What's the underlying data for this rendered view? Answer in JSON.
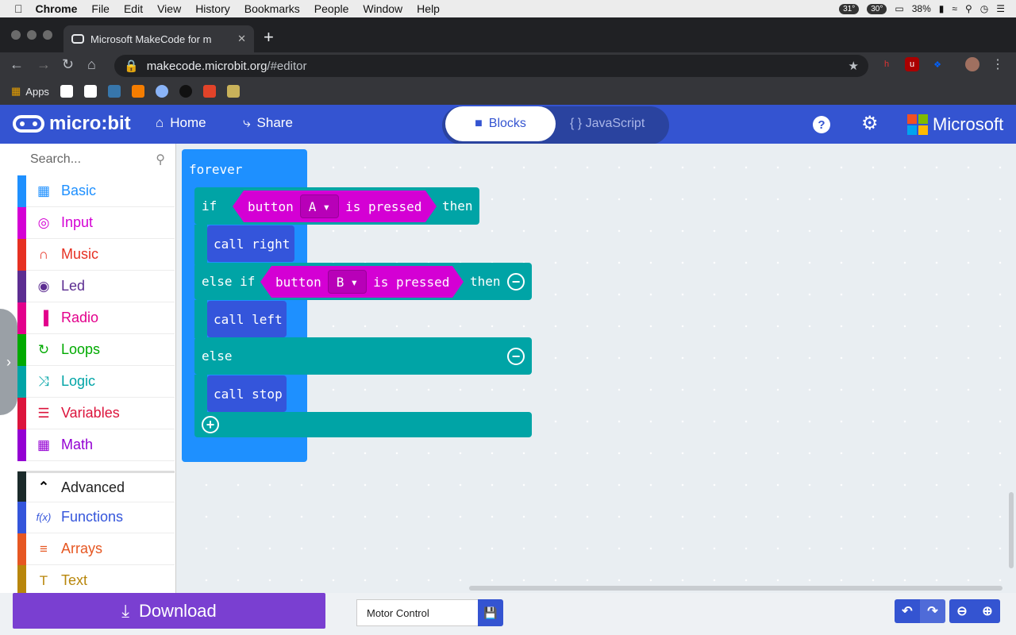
{
  "os_menubar": {
    "app": "Chrome",
    "menus": [
      "File",
      "Edit",
      "View",
      "History",
      "Bookmarks",
      "People",
      "Window",
      "Help"
    ],
    "temp1": "31°",
    "temp2": "30°",
    "battery": "38%"
  },
  "browser": {
    "tab_title": "Microsoft MakeCode for m",
    "url_host": "makecode.microbit.org",
    "url_path": "/#editor",
    "bookmarks_label": "Apps"
  },
  "header": {
    "logo": "micro:bit",
    "home": "Home",
    "share": "Share",
    "blocks": "Blocks",
    "javascript": "{ } JavaScript",
    "help": "?",
    "brand": "Microsoft"
  },
  "sidebar": {
    "search_placeholder": "Search...",
    "categories": [
      {
        "label": "Basic",
        "color": "#1e90ff",
        "icon": "grid-icon"
      },
      {
        "label": "Input",
        "color": "#d400d4",
        "icon": "target-icon"
      },
      {
        "label": "Music",
        "color": "#e63022",
        "icon": "headphones-icon"
      },
      {
        "label": "Led",
        "color": "#5c2d91",
        "icon": "toggle-icon"
      },
      {
        "label": "Radio",
        "color": "#e3008c",
        "icon": "signal-icon"
      },
      {
        "label": "Loops",
        "color": "#00aa00",
        "icon": "loop-icon"
      },
      {
        "label": "Logic",
        "color": "#00a4a6",
        "icon": "shuffle-icon"
      },
      {
        "label": "Variables",
        "color": "#dc143c",
        "icon": "lines-icon"
      },
      {
        "label": "Math",
        "color": "#9400d3",
        "icon": "calculator-icon"
      }
    ],
    "advanced": "Advanced",
    "advanced_categories": [
      {
        "label": "Functions",
        "color": "#3455db",
        "icon": "fx-icon"
      },
      {
        "label": "Arrays",
        "color": "#e65722",
        "icon": "list-icon"
      },
      {
        "label": "Text",
        "color": "#b8860b",
        "icon": "text-icon"
      }
    ]
  },
  "blocks": {
    "forever": "forever",
    "if": "if",
    "button": "button",
    "a": "A",
    "b": "B",
    "is_pressed": "is pressed",
    "then": "then",
    "else_if": "else if",
    "else": "else",
    "call_right": "call right",
    "call_left": "call left",
    "call_stop": "call stop"
  },
  "footer": {
    "download": "Download",
    "project_name": "Motor Control"
  },
  "colors": {
    "header": "#3454d1",
    "download": "#7a3fd1",
    "logic": "#00a4a6",
    "input": "#d400d4",
    "basic": "#1e90ff",
    "functions": "#3455db"
  }
}
